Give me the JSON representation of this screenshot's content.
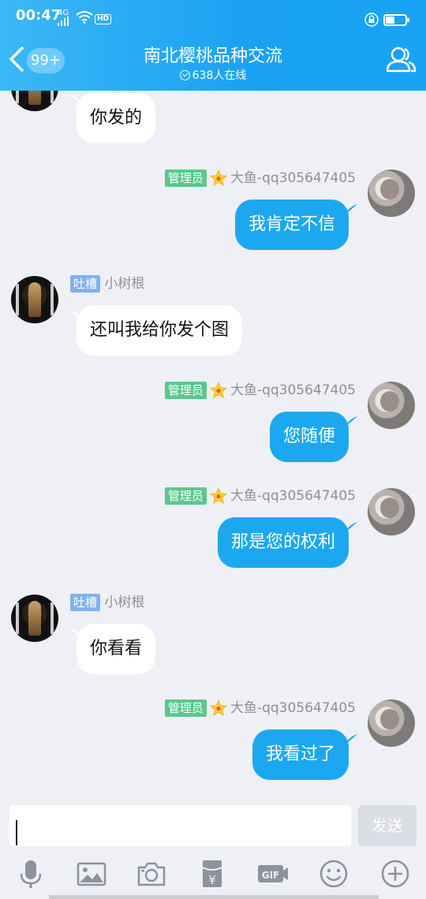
{
  "status_bar": {
    "time": "00:47",
    "network": "4G",
    "hd": "HD"
  },
  "header": {
    "unread_badge": "99+",
    "title": "南北樱桃品种交流",
    "online_text": "638人在线"
  },
  "messages": [
    {
      "side": "left",
      "avatar_icon": "avatar-xiaoshugen",
      "text": "你发的"
    },
    {
      "side": "right",
      "role": "管理员",
      "name": "大鱼-qq305647405",
      "avatar_icon": "avatar-dayu",
      "text": "我肯定不信"
    },
    {
      "side": "left",
      "role": "吐槽",
      "name": "小树根",
      "avatar_icon": "avatar-xiaoshugen",
      "text": "还叫我给你发个图"
    },
    {
      "side": "right",
      "role": "管理员",
      "name": "大鱼-qq305647405",
      "avatar_icon": "avatar-dayu",
      "text": "您随便"
    },
    {
      "side": "right",
      "role": "管理员",
      "name": "大鱼-qq305647405",
      "avatar_icon": "avatar-dayu",
      "text": "那是您的权利"
    },
    {
      "side": "left",
      "role": "吐槽",
      "name": "小树根",
      "avatar_icon": "avatar-xiaoshugen",
      "text": "你看看"
    },
    {
      "side": "right",
      "role": "管理员",
      "name": "大鱼-qq305647405",
      "avatar_icon": "avatar-dayu",
      "text": "我看过了"
    }
  ],
  "composer": {
    "input_value": "",
    "send_label": "发送",
    "tools": [
      "mic-icon",
      "image-icon",
      "camera-icon",
      "red-packet-icon",
      "gif-icon",
      "emoji-icon",
      "plus-icon"
    ]
  },
  "colors": {
    "header_start": "#3bb8f5",
    "header_end": "#19a3f5",
    "bubble_out": "#1ca8f0",
    "admin_tag": "#5ac88c",
    "tucao_tag": "#7fb2ee"
  }
}
